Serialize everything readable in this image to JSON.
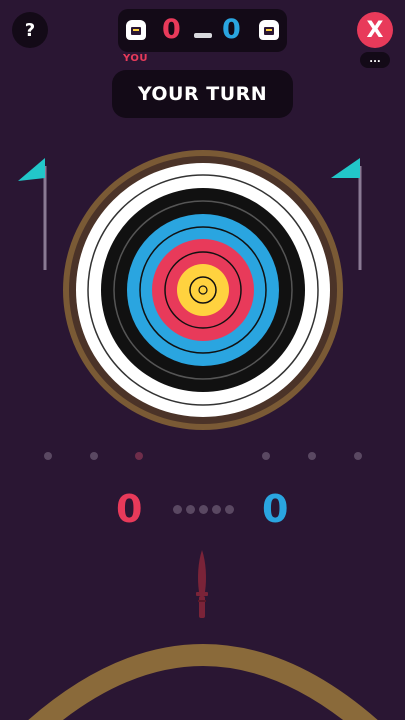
{
  "header": {
    "help_label": "?",
    "close_label": "X",
    "more_label": "..."
  },
  "scoreboard": {
    "player_score": "0",
    "opponent_score": "0",
    "player_tag": "YOU",
    "player_color": "#e83a5a",
    "opponent_color": "#2aa5e0"
  },
  "turn_banner": "YOUR TURN",
  "board": {
    "flag_color": "#22c7c9",
    "ring_colors": [
      "#ffffff",
      "#111111",
      "#2aa5e0",
      "#e83a5a",
      "#ffd23f"
    ]
  },
  "throws": {
    "player_total": 3,
    "opponent_total": 3,
    "current_player_throw": 3
  },
  "round_score": {
    "player": "0",
    "opponent": "0",
    "round_dots": 5
  },
  "icons": {
    "player_avatar": "player-avatar-icon",
    "opponent_avatar": "opponent-avatar-icon",
    "knife": "knife-icon",
    "flag": "flag-icon"
  }
}
